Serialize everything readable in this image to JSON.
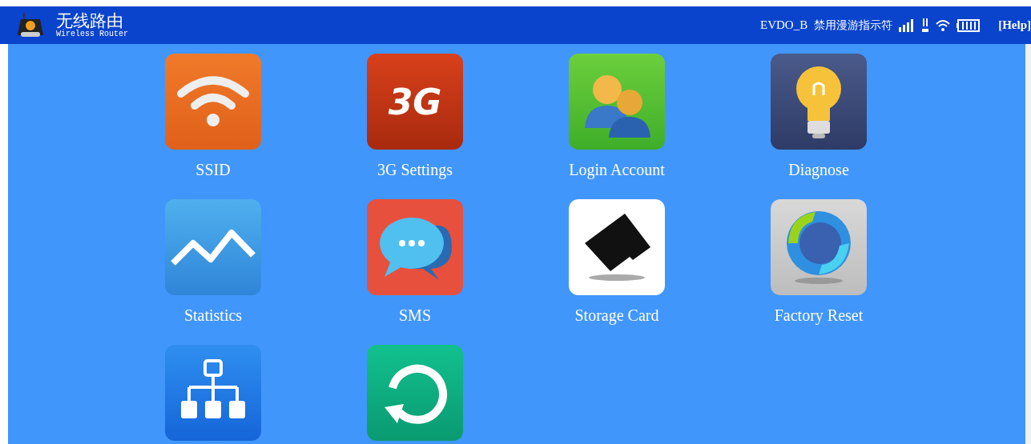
{
  "header": {
    "title": "无线路由",
    "subtitle": "Wireless Router",
    "network": "EVDO_B",
    "roaming": "禁用漫游指示符",
    "help": "[Help]"
  },
  "tiles": [
    {
      "kind": "wifi",
      "label": "SSID"
    },
    {
      "kind": "cellular",
      "label": "3G Settings",
      "badge": "3G"
    },
    {
      "kind": "account",
      "label": "Login Account"
    },
    {
      "kind": "bulb",
      "label": "Diagnose"
    },
    {
      "kind": "chart",
      "label": "Statistics"
    },
    {
      "kind": "sms",
      "label": "SMS"
    },
    {
      "kind": "sdcard",
      "label": "Storage Card"
    },
    {
      "kind": "reset",
      "label": "Factory Reset"
    },
    {
      "kind": "network"
    },
    {
      "kind": "update"
    }
  ]
}
